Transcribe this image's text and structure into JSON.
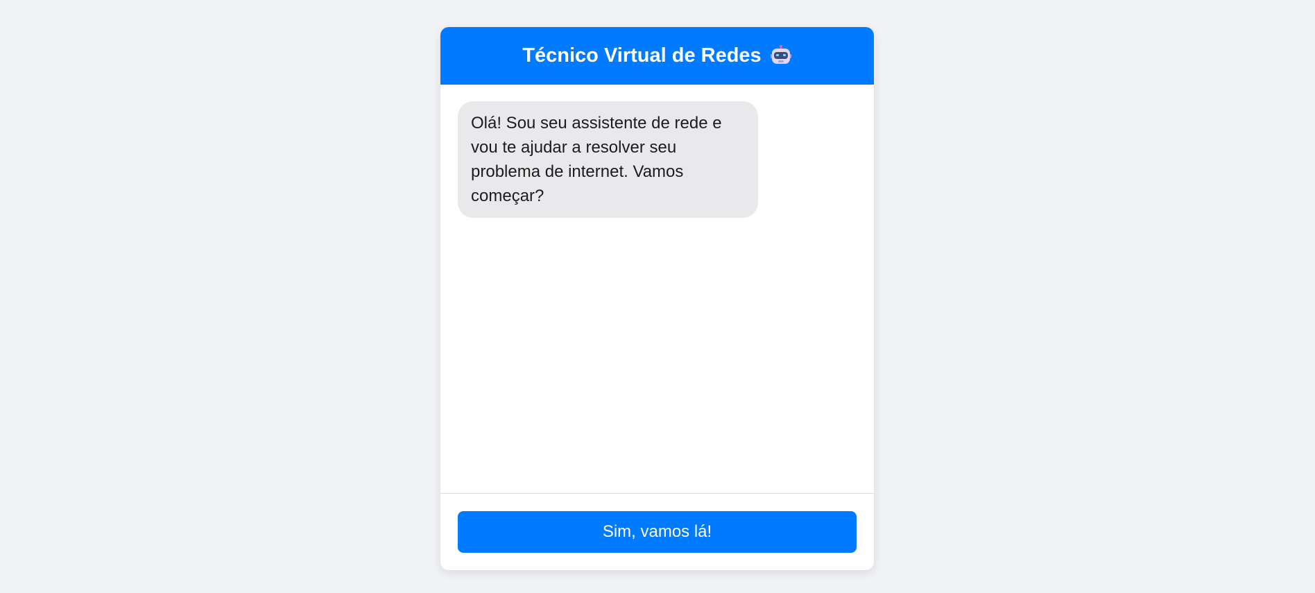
{
  "header": {
    "title": "Técnico Virtual de Redes",
    "icon": "robot-icon"
  },
  "messages": [
    {
      "sender": "bot",
      "text": "Olá! Sou seu assistente de rede e vou te ajudar a resolver seu problema de internet. Vamos começar?"
    }
  ],
  "footer": {
    "action_label": "Sim, vamos lá!"
  },
  "colors": {
    "accent": "#007bff",
    "background": "#f0f2f5",
    "bot_bubble": "#e9e9eb"
  }
}
